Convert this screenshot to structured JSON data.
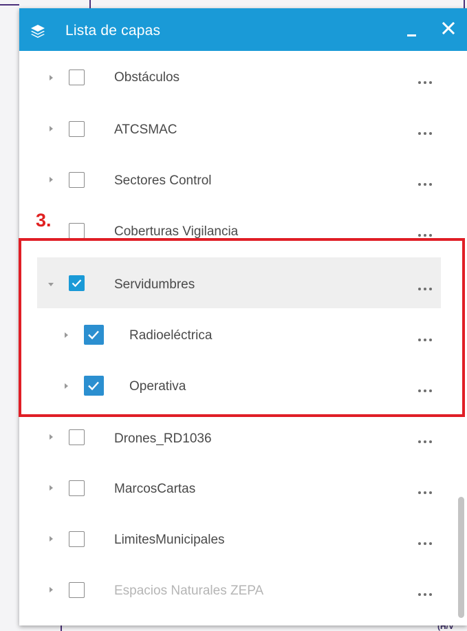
{
  "panel": {
    "title": "Lista de capas",
    "header_color": "#1a9ad7",
    "header_icon": "layers-icon",
    "minimize_icon": "minimize-icon",
    "close_icon": "close-icon"
  },
  "annotation": {
    "step_label": "3.",
    "color": "#e01e26"
  },
  "layers": [
    {
      "label": "Obstáculos",
      "checked": false,
      "expanded": false
    },
    {
      "label": "ATCSMAC",
      "checked": false,
      "expanded": false
    },
    {
      "label": "Sectores Control",
      "checked": false,
      "expanded": false
    },
    {
      "label": "Coberturas Vigilancia",
      "checked": false,
      "expanded": false
    },
    {
      "label": "Servidumbres",
      "checked": true,
      "expanded": true,
      "selected": true,
      "children": [
        {
          "label": "Radioeléctrica",
          "checked": true,
          "expanded": false
        },
        {
          "label": "Operativa",
          "checked": true,
          "expanded": false
        }
      ]
    },
    {
      "label": "Drones_RD1036",
      "checked": false,
      "expanded": false
    },
    {
      "label": "MarcosCartas",
      "checked": false,
      "expanded": false
    },
    {
      "label": "LimitesMunicipales",
      "checked": false,
      "expanded": false
    },
    {
      "label": "Espacios Naturales ZEPA",
      "checked": false,
      "expanded": false,
      "disabled": true
    }
  ],
  "more_icon": "more-options-icon",
  "map_text": {
    "bottom_right": "(H/V"
  }
}
